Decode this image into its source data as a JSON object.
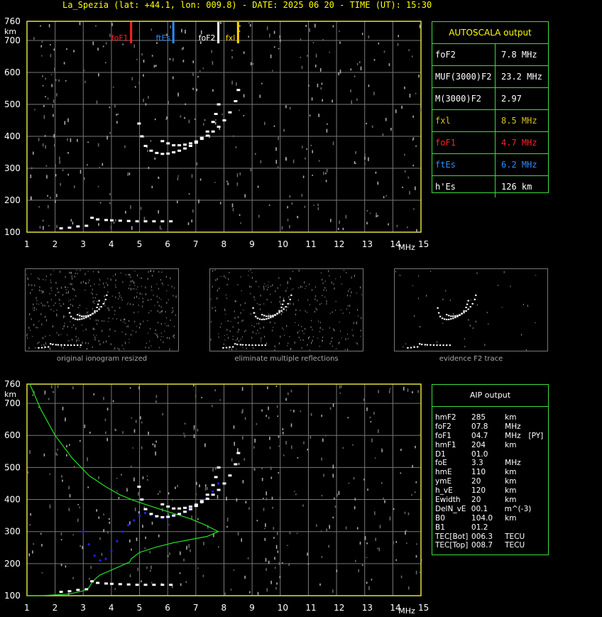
{
  "header": {
    "title": "La_Spezia (lat: +44.1, lon: 009.8) - DATE: 2025 06 20 - TIME (UT): 15:30"
  },
  "axes": {
    "y_ticks": [
      "760",
      "700",
      "600",
      "500",
      "400",
      "300",
      "200",
      "100"
    ],
    "y_unit": "km",
    "x_ticks": [
      "1",
      "2",
      "3",
      "4",
      "5",
      "6",
      "7",
      "8",
      "9",
      "10",
      "11",
      "12",
      "13",
      "14",
      "15"
    ],
    "x_unit": "MHz"
  },
  "markers": [
    {
      "label": "foF1",
      "freq": 4.7,
      "color": "#ff2020"
    },
    {
      "label": "ftEs",
      "freq": 6.2,
      "color": "#2a8cff"
    },
    {
      "label": "foF2",
      "freq": 7.8,
      "color": "#ffffff"
    },
    {
      "label": "fxl",
      "freq": 8.5,
      "color": "#ffd800"
    }
  ],
  "autoscala": {
    "title": "AUTOSCALA output",
    "rows": [
      {
        "key": "foF2",
        "value": "7.8 MHz",
        "color": "#ffffff"
      },
      {
        "key": "MUF(3000)F2",
        "value": "23.2 MHz",
        "color": "#ffffff"
      },
      {
        "key": "M(3000)F2",
        "value": "2.97",
        "color": "#ffffff"
      },
      {
        "key": "fxl",
        "value": "8.5 MHz",
        "color": "#d8c020"
      },
      {
        "key": "foF1",
        "value": "4.7 MHz",
        "color": "#ff2020"
      },
      {
        "key": "ftEs",
        "value": "6.2 MHz",
        "color": "#2a8cff"
      },
      {
        "key": "h'Es",
        "value": "126    km",
        "color": "#ffffff"
      }
    ]
  },
  "thumbnails": [
    {
      "caption": "original ionogram resized"
    },
    {
      "caption": "eliminate multiple reflections"
    },
    {
      "caption": "evidence F2 trace"
    }
  ],
  "aip": {
    "title": "AIP output",
    "rows": [
      [
        "hmF2",
        "285",
        "km",
        ""
      ],
      [
        "foF2",
        "07.8",
        "MHz",
        ""
      ],
      [
        "foF1",
        "04.7",
        "MHz",
        "[PY]"
      ],
      [
        "hmF1",
        "204",
        "km",
        ""
      ],
      [
        "D1",
        "01.0",
        "",
        ""
      ],
      [
        "foE",
        "3.3",
        "MHz",
        ""
      ],
      [
        "hmE",
        "110",
        "km",
        ""
      ],
      [
        "ymE",
        "20",
        "km",
        ""
      ],
      [
        "h_vE",
        "120",
        "km",
        ""
      ],
      [
        "Ewidth",
        "20",
        "km",
        ""
      ],
      [
        "DelN_vE",
        "00.1",
        "m^(-3)",
        ""
      ],
      [
        "B0",
        "104.0",
        "km",
        ""
      ],
      [
        "B1",
        "01.2",
        "",
        ""
      ],
      [
        "TEC[Bot]",
        "006.3",
        "TECU",
        ""
      ],
      [
        "TEC[Top]",
        "008.7",
        "TECU",
        ""
      ]
    ]
  },
  "chart_data": [
    {
      "type": "scatter",
      "title": "",
      "xlabel": "MHz",
      "ylabel": "km",
      "xlim": [
        1,
        15
      ],
      "ylim": [
        100,
        760
      ],
      "series": [
        {
          "name": "",
          "color": "#ffffff",
          "x": [
            4.97,
            5.07,
            5.2,
            5.4,
            5.6,
            5.8,
            6.0,
            6.2,
            6.4,
            6.6,
            6.8,
            7.0,
            7.2,
            7.4,
            7.6,
            7.7,
            7.8
          ],
          "y": [
            440,
            400,
            370,
            355,
            348,
            345,
            346,
            350,
            355,
            362,
            370,
            380,
            395,
            415,
            445,
            470,
            500
          ]
        },
        {
          "name": "",
          "color": "#ffffff",
          "x": [
            5.8,
            6.0,
            6.2,
            6.4,
            6.6,
            6.8,
            7.0,
            7.2,
            7.4,
            7.6,
            7.8,
            8.0,
            8.2,
            8.4,
            8.5
          ],
          "y": [
            385,
            378,
            372,
            372,
            374,
            378,
            384,
            392,
            402,
            415,
            430,
            450,
            475,
            510,
            545
          ]
        },
        {
          "name": "",
          "color": "#ffffff",
          "x": [
            3.3,
            3.5,
            3.8,
            4.0,
            4.3,
            4.6,
            4.9,
            5.2,
            5.5,
            5.8,
            6.1,
            2.2,
            2.5,
            2.8,
            3.1
          ],
          "y": [
            145,
            140,
            138,
            137,
            136,
            135,
            134,
            134,
            134,
            134,
            134,
            112,
            114,
            118,
            120
          ]
        }
      ]
    },
    {
      "type": "line",
      "title": "",
      "xlabel": "MHz",
      "ylabel": "km",
      "xlim": [
        1,
        15
      ],
      "ylim": [
        100,
        760
      ],
      "series": [
        {
          "name": "",
          "color": "#20e020",
          "x": [
            1.1,
            1.5,
            2.0,
            2.6,
            3.2,
            3.8,
            4.3,
            4.8,
            5.3,
            5.8,
            6.3,
            6.8,
            7.3,
            7.8,
            7.4,
            6.8,
            6.2,
            5.6,
            5.0,
            4.7,
            4.65,
            4.0,
            3.6,
            3.4,
            3.3,
            3.2,
            3.0,
            2.5,
            1.5,
            1.0
          ],
          "y": [
            760,
            680,
            600,
            530,
            475,
            440,
            415,
            397,
            382,
            368,
            354,
            340,
            322,
            300,
            285,
            275,
            265,
            252,
            235,
            215,
            205,
            180,
            165,
            150,
            140,
            125,
            115,
            105,
            100,
            100
          ]
        },
        {
          "name": "",
          "color": "#2020ff",
          "x": [
            3.0,
            3.2,
            3.4,
            3.6,
            3.8,
            4.0,
            4.2,
            4.4,
            4.6,
            4.8,
            5.0,
            5.2,
            5.4,
            5.6,
            5.8,
            6.0,
            6.2,
            6.4,
            6.6,
            6.8,
            7.0,
            7.2,
            7.4,
            7.6,
            7.8
          ],
          "y": [
            300,
            260,
            225,
            210,
            215,
            240,
            270,
            300,
            320,
            335,
            350,
            358,
            352,
            345,
            343,
            344,
            348,
            353,
            360,
            368,
            378,
            390,
            405,
            425,
            450
          ]
        }
      ]
    }
  ]
}
